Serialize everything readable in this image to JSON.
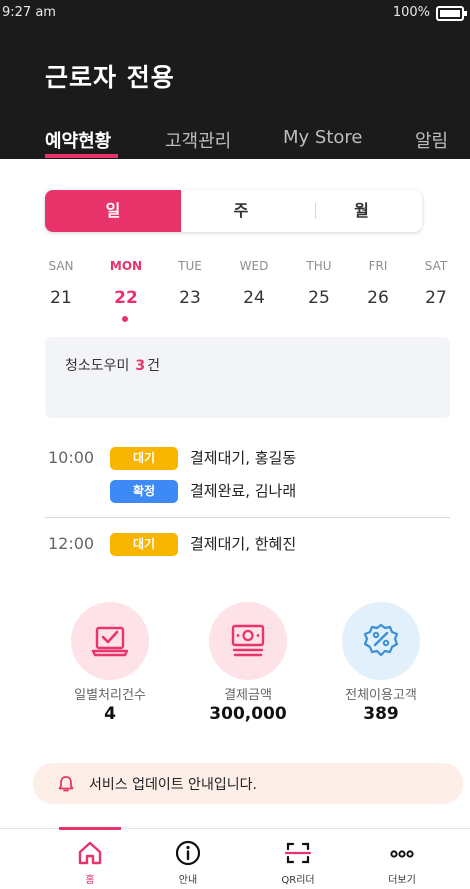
{
  "status": {
    "time": "9:27 am",
    "battery": "100%"
  },
  "header": {
    "title": "근로자 전용",
    "tabs": [
      {
        "label": "예약현황",
        "active": true
      },
      {
        "label": "고객관리",
        "active": false
      },
      {
        "label": "My Store",
        "active": false
      },
      {
        "label": "알림",
        "active": false
      }
    ]
  },
  "period": {
    "day": "일",
    "week": "주",
    "month": "월",
    "selected": "day"
  },
  "week": [
    {
      "dow": "SAN",
      "date": "21"
    },
    {
      "dow": "MON",
      "date": "22",
      "selected": true
    },
    {
      "dow": "TUE",
      "date": "23"
    },
    {
      "dow": "WED",
      "date": "24"
    },
    {
      "dow": "THU",
      "date": "25"
    },
    {
      "dow": "FRI",
      "date": "26"
    },
    {
      "dow": "SAT",
      "date": "27"
    }
  ],
  "summary": {
    "service": "청소도우미",
    "count": "3",
    "unit": "건"
  },
  "schedule": [
    {
      "time": "10:00",
      "badge": "대기",
      "text": "결제대기, 홍길동"
    },
    {
      "time": "",
      "badge": "확정",
      "text": "결제완료, 김나래"
    },
    {
      "time": "12:00",
      "badge": "대기",
      "text": "결제대기, 한혜진"
    }
  ],
  "stats": [
    {
      "label": "일별처리건수",
      "value": "4",
      "icon": "laptop-check-icon"
    },
    {
      "label": "결제금액",
      "value": "300,000",
      "icon": "cash-icon"
    },
    {
      "label": "전체이용고객",
      "value": "389",
      "icon": "percent-badge-icon"
    }
  ],
  "notice": {
    "text": "서비스 업데이트 안내입니다.",
    "icon": "bell-icon"
  },
  "nav": [
    {
      "label": "홈",
      "icon": "home-icon",
      "active": true
    },
    {
      "label": "안내",
      "icon": "info-icon"
    },
    {
      "label": "QR리더",
      "icon": "qr-scan-icon"
    },
    {
      "label": "더보기",
      "icon": "more-icon"
    }
  ],
  "colors": {
    "accent": "#e8336b",
    "header_bg": "#1b1b1b",
    "badge_wait": "#f7b500",
    "badge_confirm": "#3d8af7",
    "notice_bg": "#fdeee8"
  }
}
